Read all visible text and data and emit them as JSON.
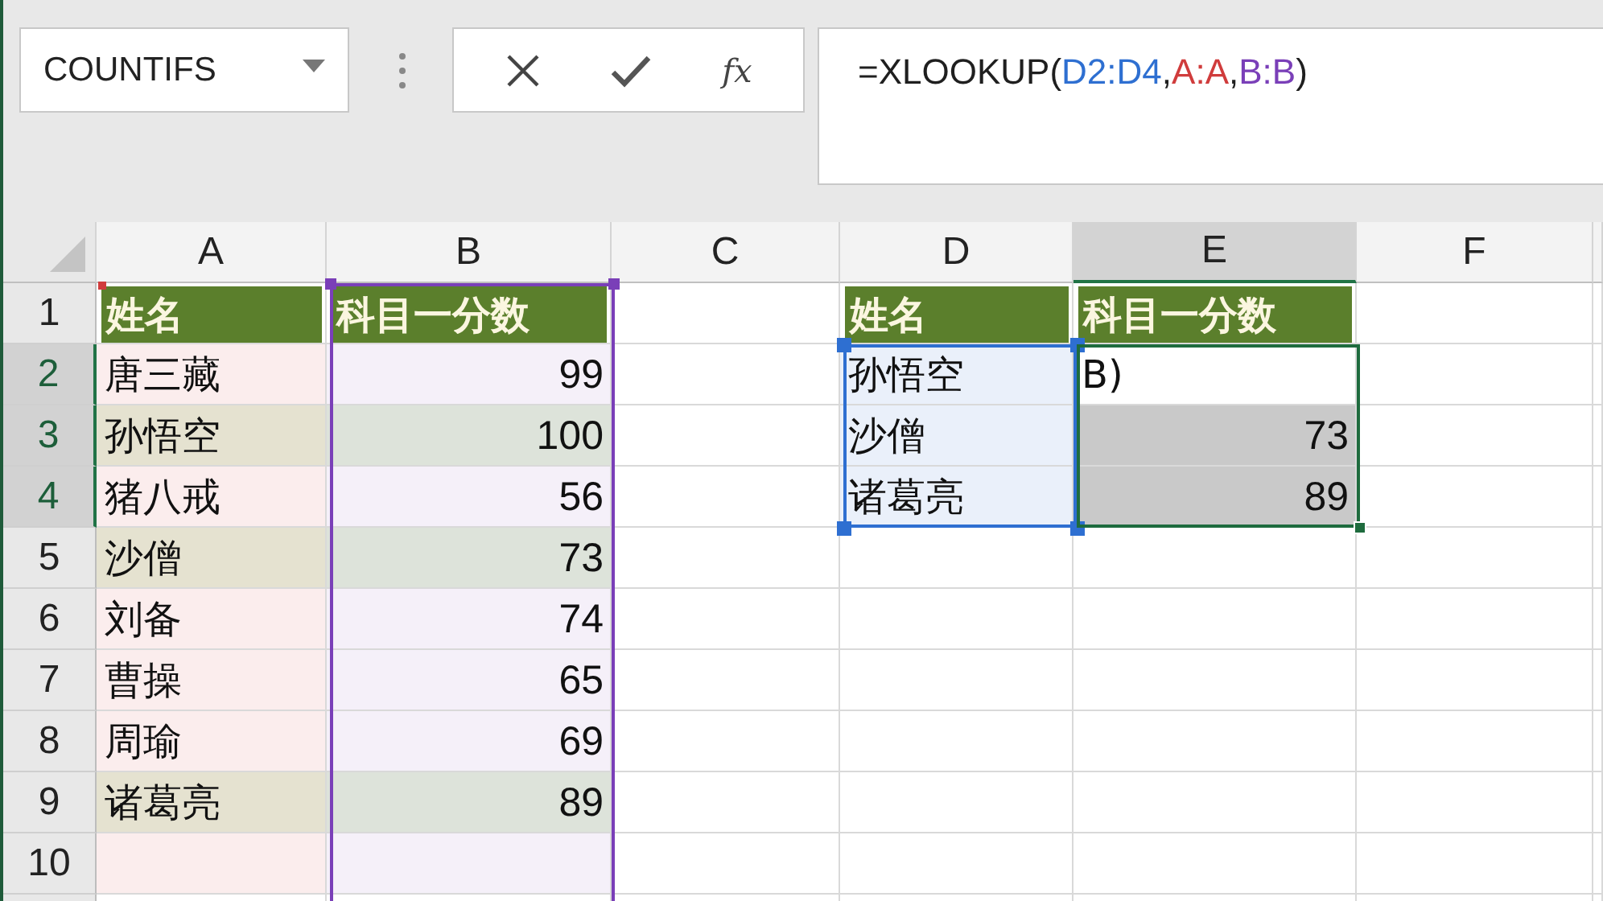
{
  "name_box": {
    "value": "COUNTIFS"
  },
  "formula_buttons": [
    {
      "kind": "cancel"
    },
    {
      "kind": "enter"
    },
    {
      "kind": "function",
      "label": "fx"
    }
  ],
  "formula_bar": {
    "parts": [
      {
        "text": "=XLOOKUP(",
        "color": "#1f1f1f"
      },
      {
        "text": "D2:D4",
        "color": "#2e6fd1"
      },
      {
        "text": ",",
        "color": "#1f1f1f"
      },
      {
        "text": "A:A",
        "color": "#d03c3c"
      },
      {
        "text": ",",
        "color": "#1f1f1f"
      },
      {
        "text": "B:B",
        "color": "#7a3fb8"
      },
      {
        "text": ")",
        "color": "#1f1f1f"
      }
    ]
  },
  "column_headers": [
    {
      "label": "A",
      "selected": false
    },
    {
      "label": "B",
      "selected": false
    },
    {
      "label": "C",
      "selected": false
    },
    {
      "label": "D",
      "selected": false
    },
    {
      "label": "E",
      "selected": true
    },
    {
      "label": "F",
      "selected": false
    }
  ],
  "row_headers": [
    {
      "label": "1",
      "selected": false
    },
    {
      "label": "2",
      "selected": true
    },
    {
      "label": "3",
      "selected": true
    },
    {
      "label": "4",
      "selected": true
    },
    {
      "label": "5",
      "selected": false
    },
    {
      "label": "6",
      "selected": false
    },
    {
      "label": "7",
      "selected": false
    },
    {
      "label": "8",
      "selected": false
    },
    {
      "label": "9",
      "selected": false
    },
    {
      "label": "10",
      "selected": false
    }
  ],
  "source_table": {
    "header": [
      "姓名",
      "科目一分数"
    ],
    "rows": [
      {
        "name": "唐三藏",
        "score": "99",
        "matched": false
      },
      {
        "name": "孙悟空",
        "score": "100",
        "matched": true
      },
      {
        "name": "猪八戒",
        "score": "56",
        "matched": false
      },
      {
        "name": "沙僧",
        "score": "73",
        "matched": true
      },
      {
        "name": "刘备",
        "score": "74",
        "matched": false
      },
      {
        "name": "曹操",
        "score": "65",
        "matched": false
      },
      {
        "name": "周瑜",
        "score": "69",
        "matched": false
      },
      {
        "name": "诸葛亮",
        "score": "89",
        "matched": true
      }
    ]
  },
  "lookup_table": {
    "header": [
      "姓名",
      "科目一分数"
    ],
    "rows": [
      {
        "name": "孙悟空",
        "result": "B)",
        "spilled": false
      },
      {
        "name": "沙僧",
        "result": "73",
        "spilled": true
      },
      {
        "name": "诸葛亮",
        "result": "89",
        "spilled": true
      }
    ]
  }
}
